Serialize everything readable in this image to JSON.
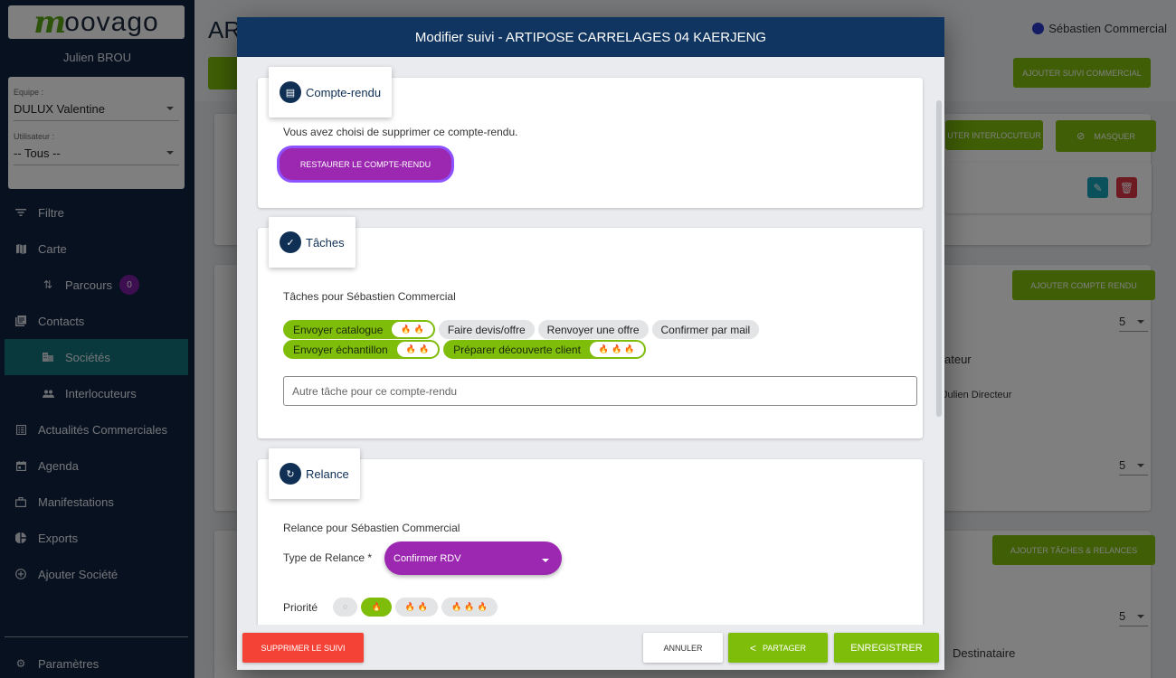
{
  "sidebar": {
    "logo": {
      "mark": "m",
      "rest": "oovago"
    },
    "user_name": "Julien BROU",
    "filters": {
      "team_label": "Equipe :",
      "team_value": "DULUX Valentine",
      "user_label": "Utilisateur :",
      "user_value": "-- Tous --"
    },
    "items": [
      {
        "label": "Filtre",
        "icon": "filter-icon"
      },
      {
        "label": "Carte",
        "icon": "map-icon"
      },
      {
        "label": "Parcours",
        "icon": "route-icon",
        "badge": "0"
      },
      {
        "label": "Contacts",
        "icon": "contacts-icon"
      },
      {
        "label": "Sociétés",
        "icon": "building-icon",
        "active": true
      },
      {
        "label": "Interlocuteurs",
        "icon": "people-icon"
      },
      {
        "label": "Actualités Commerciales",
        "icon": "news-icon"
      },
      {
        "label": "Agenda",
        "icon": "calendar-icon"
      },
      {
        "label": "Manifestations",
        "icon": "briefcase-icon"
      },
      {
        "label": "Exports",
        "icon": "pie-chart-icon"
      },
      {
        "label": "Ajouter Société",
        "icon": "add-circle-icon"
      }
    ],
    "bottom_item": {
      "label": "Paramètres",
      "icon": "gear-icon"
    }
  },
  "background": {
    "page_title": "AR",
    "current_user": "Sébastien Commercial",
    "buttons": {
      "add_followup": "Ajouter suivi commercial",
      "add_contact": "UTER INTERLOCUTEUR",
      "hide": "Masquer",
      "add_report": "Ajouter compte rendu",
      "add_tasks": "Ajouter tâches & relances"
    },
    "per_page_1": "5",
    "per_page_2": "5",
    "per_page_3": "5",
    "col_fragment": "ateur",
    "row_fragment": "Julien Directeur",
    "col_recipient": "Destinataire"
  },
  "modal": {
    "title": "Modifier suivi - ARTIPOSE CARRELAGES 04 KAERJENG",
    "report": {
      "title": "Compte-rendu",
      "message": "Vous avez choisi de supprimer ce compte-rendu.",
      "restore_label": "Restaurer le compte-rendu"
    },
    "tasks": {
      "title": "Tâches",
      "subtitle": "Tâches pour Sébastien Commercial",
      "chips_row1": [
        {
          "label": "Envoyer catalogue",
          "selected": true,
          "priority": 2
        },
        {
          "label": "Faire devis/offre",
          "selected": false
        },
        {
          "label": "Renvoyer une offre",
          "selected": false
        },
        {
          "label": "Confirmer par mail",
          "selected": false
        }
      ],
      "chips_row2": [
        {
          "label": "Envoyer échantillon",
          "selected": true,
          "priority": 2
        },
        {
          "label": "Préparer découverte client",
          "selected": true,
          "priority": 3
        }
      ],
      "other_task_placeholder": "Autre tâche pour ce compte-rendu"
    },
    "relance": {
      "title": "Relance",
      "subtitle": "Relance pour Sébastien Commercial",
      "type_label": "Type de Relance *",
      "type_value": "Confirmer RDV",
      "priority_label": "Priorité",
      "priority_options": [
        0,
        1,
        2,
        3
      ],
      "priority_selected": 1
    },
    "footer": {
      "delete_label": "Supprimer le suivi",
      "cancel_label": "Annuler",
      "share_label": "Partager",
      "save_label": "Enregistrer"
    }
  },
  "colors": {
    "brand_green": "#7fbd0b",
    "accent_purple": "#9c27b0",
    "navy": "#0f3560",
    "danger": "#f44336"
  }
}
